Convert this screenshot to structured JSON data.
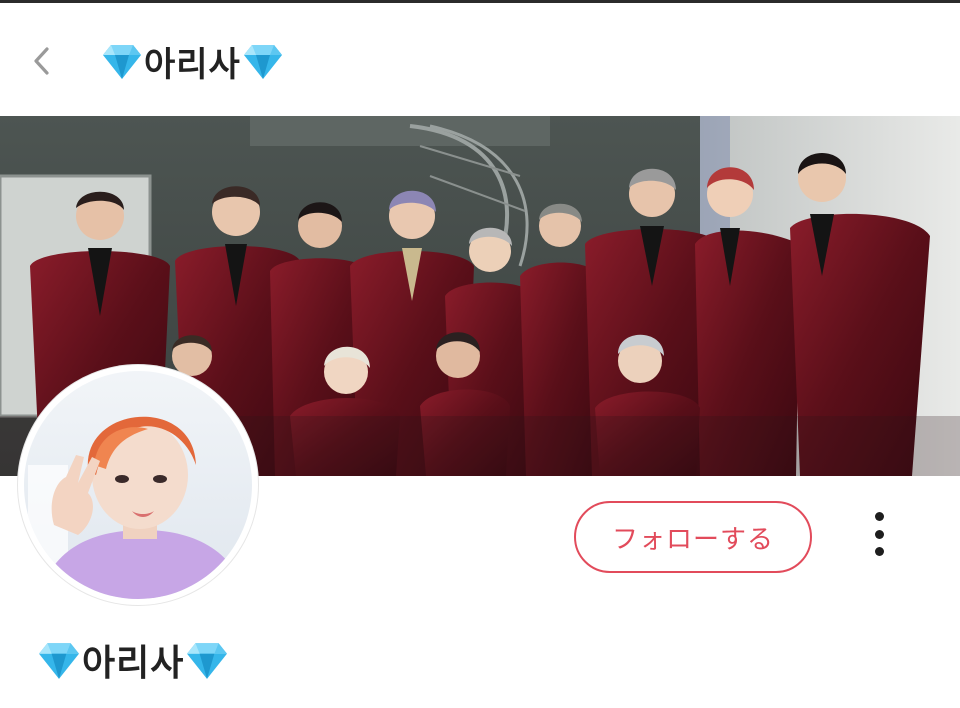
{
  "header": {
    "title": "아리사",
    "back_icon": "chevron-left-icon",
    "title_emoji": "gem-icon"
  },
  "cover": {
    "icon": "cover-photo"
  },
  "profile": {
    "name": "아리사",
    "name_emoji": "gem-icon",
    "follow_label": "フォローする",
    "more_icon": "more-vertical-icon"
  },
  "colors": {
    "accent": "#e24b5b",
    "gem": "#35b6ea",
    "text": "#222222"
  }
}
